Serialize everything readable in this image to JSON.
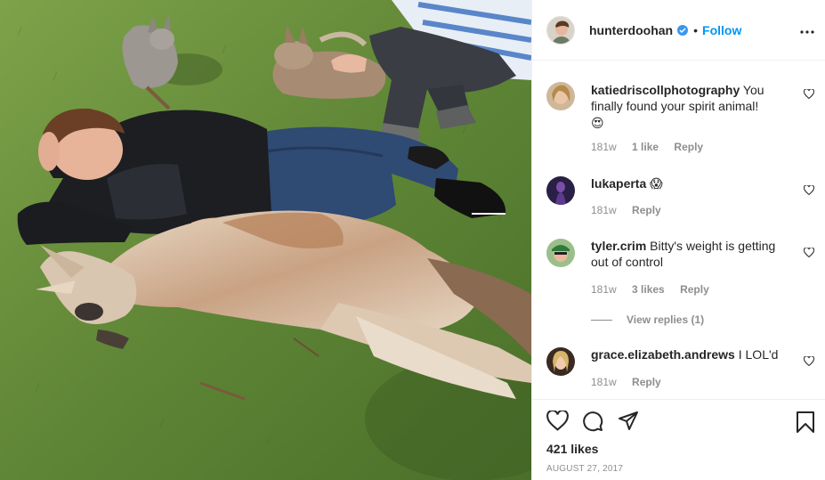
{
  "post": {
    "author": "hunterdoohan",
    "verified": true,
    "separator": "•",
    "follow_label": "Follow",
    "likes": "421 likes",
    "date": "AUGUST 27, 2017"
  },
  "comments": [
    {
      "user": "katiedriscollphotography",
      "text": "You finally found your spirit animal!",
      "emoji": "😍",
      "time": "181w",
      "likes": "1 like",
      "reply": "Reply"
    },
    {
      "user": "lukaperta",
      "text": "",
      "emoji": "😱",
      "time": "181w",
      "reply": "Reply"
    },
    {
      "user": "tyler.crim",
      "text": "Bitty's weight is getting out of control",
      "time": "181w",
      "likes": "3 likes",
      "reply": "Reply",
      "view_replies": "View replies (1)"
    },
    {
      "user": "grace.elizabeth.andrews",
      "text": "I LOL'd",
      "time": "181w",
      "reply": "Reply"
    }
  ],
  "icons": {
    "like": "heart-icon",
    "comment": "comment-icon",
    "share": "send-icon",
    "save": "bookmark-icon",
    "more": "more-options-icon",
    "verified": "verified-badge-icon"
  },
  "colors": {
    "accent": "#0095f6",
    "verified": "#3897f0",
    "muted": "#8e8e8e",
    "text": "#262626"
  }
}
